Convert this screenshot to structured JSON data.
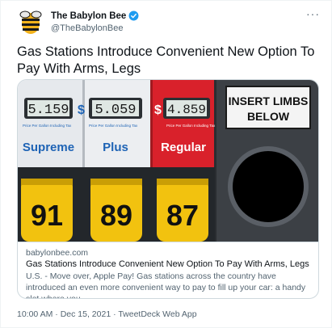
{
  "tweet": {
    "author": {
      "display_name": "The Babylon Bee",
      "handle": "@TheBabylonBee",
      "verified": true,
      "avatar_icon": "bee-logo-icon"
    },
    "more_label": "···",
    "text": "Gas Stations Introduce Convenient New Option To Pay With Arms, Legs",
    "card": {
      "image": {
        "price_1": "5.159",
        "price_2": "5.059",
        "price_3": "4.859",
        "dollar": "$",
        "price_caption": "Price Per Gallon Including Tax",
        "grade_1": "Supreme",
        "grade_2": "Plus",
        "grade_3": "Regular",
        "octane_1": "91",
        "octane_2": "89",
        "octane_3": "87",
        "sign_line_1": "INSERT LIMBS",
        "sign_line_2": "BELOW"
      },
      "domain": "babylonbee.com",
      "title": "Gas Stations Introduce Convenient New Option To Pay With Arms, Legs",
      "description": "U.S. - Move over, Apple Pay! Gas stations across the country have introduced an even more convenient way to pay to fill up your car: a handy slot where you ..."
    },
    "timestamp": "10:00 AM · Dec 15, 2021",
    "separator": " · ",
    "source": "TweetDeck Web App"
  },
  "colors": {
    "text_primary": "#0f1419",
    "text_secondary": "#536471",
    "verified_blue": "#1d9bf0",
    "border": "#cfd9de",
    "supreme_blue": "#1e63b5",
    "regular_red": "#d9212b",
    "octane_yellow": "#f2c20f"
  }
}
